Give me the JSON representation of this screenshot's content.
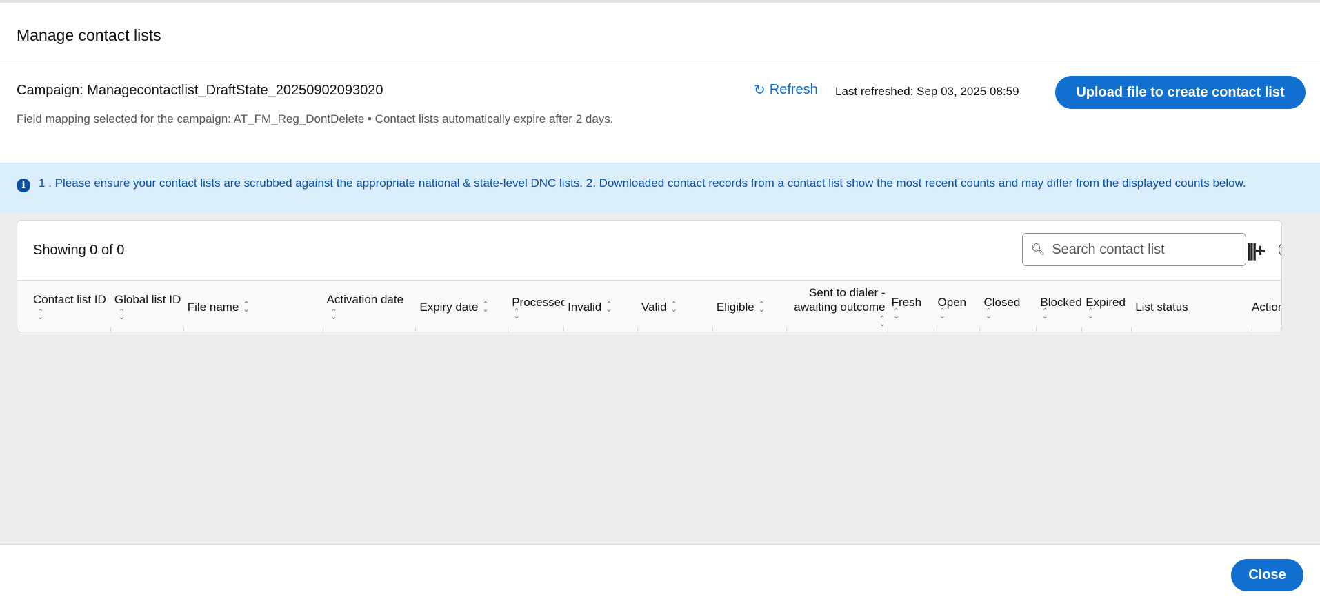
{
  "dialog": {
    "title": "Manage contact lists"
  },
  "campaign": {
    "label": "Campaign: Managecontactlist_DraftState_20250902093020",
    "subtitle": "Field mapping selected for the campaign: AT_FM_Reg_DontDelete • Contact lists automatically expire after 2 days."
  },
  "toolbar": {
    "refresh_label": "Refresh",
    "last_refreshed": "Last refreshed: Sep 03, 2025 08:59",
    "upload_label": "Upload file to create contact list"
  },
  "banner": {
    "text": "1 . Please ensure your contact lists are scrubbed against the appropriate national & state-level DNC lists. 2. Downloaded contact records from a contact list show the most recent counts and may differ from the displayed counts below."
  },
  "table": {
    "showing": "Showing 0 of 0",
    "search_placeholder": "Search contact list",
    "columns": [
      "Contact list ID",
      "Global list ID",
      "File name",
      "Activation date",
      "Expiry date",
      "Processed",
      "Invalid",
      "Valid",
      "Eligible",
      "Sent to dialer - awaiting outcome",
      "Fresh",
      "Open",
      "Closed",
      "Blocked",
      "Expired",
      "List status",
      "Action"
    ],
    "rows": []
  },
  "footer": {
    "close_label": "Close"
  },
  "colors": {
    "accent": "#1170cf",
    "banner_bg": "#dbeefc",
    "banner_text": "#0a4fa0"
  }
}
